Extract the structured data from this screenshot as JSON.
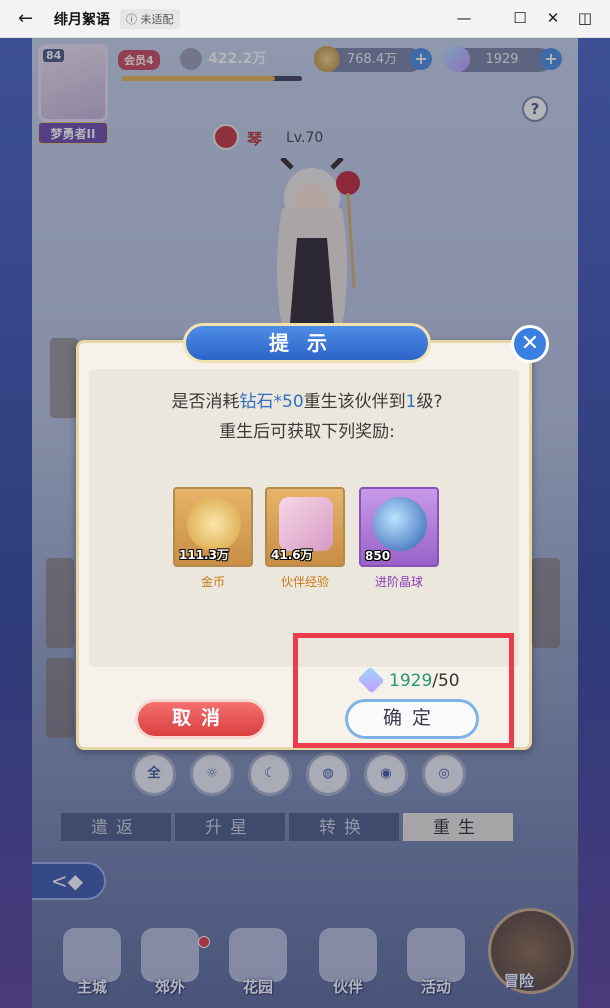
{
  "window": {
    "back_icon": "←",
    "title": "绯月絮语",
    "badge": "ⓘ 未适配",
    "controls": [
      "—",
      "☐",
      "✕",
      "◫"
    ]
  },
  "hud": {
    "level": "84",
    "player_name": "梦勇者II",
    "vip": "会员4",
    "power": "422.2万",
    "xp_fill": 0.85,
    "gold": "768.4万",
    "diamonds": "1929",
    "help": "?"
  },
  "hero": {
    "name": "琴",
    "level": "Lv.70"
  },
  "filters": [
    "全",
    "☼",
    "☾",
    "◍",
    "◉",
    "◎"
  ],
  "tabs": [
    "遣返",
    "升星",
    "转换",
    "重生"
  ],
  "nav": [
    "主城",
    "郊外",
    "花园",
    "伙伴",
    "活动",
    "冒险"
  ],
  "dialog": {
    "title": "提示",
    "question_prefix": "是否消耗",
    "question_highlight": "钻石*50",
    "question_mid": "重生该伙伴到",
    "question_level": "1",
    "question_suffix": "级?",
    "subtitle": "重生后可获取下列奖励:",
    "rewards": [
      {
        "name": "金币",
        "amount": "111.3万",
        "color": "#c77a1a"
      },
      {
        "name": "伙伴经验",
        "amount": "41.6万",
        "color": "#c77a1a"
      },
      {
        "name": "进阶晶球",
        "amount": "850",
        "color": "#8a3fb8"
      }
    ],
    "cost_have": "1929",
    "cost_need": "/50",
    "cancel": "取消",
    "confirm": "确定",
    "close": "✕"
  }
}
